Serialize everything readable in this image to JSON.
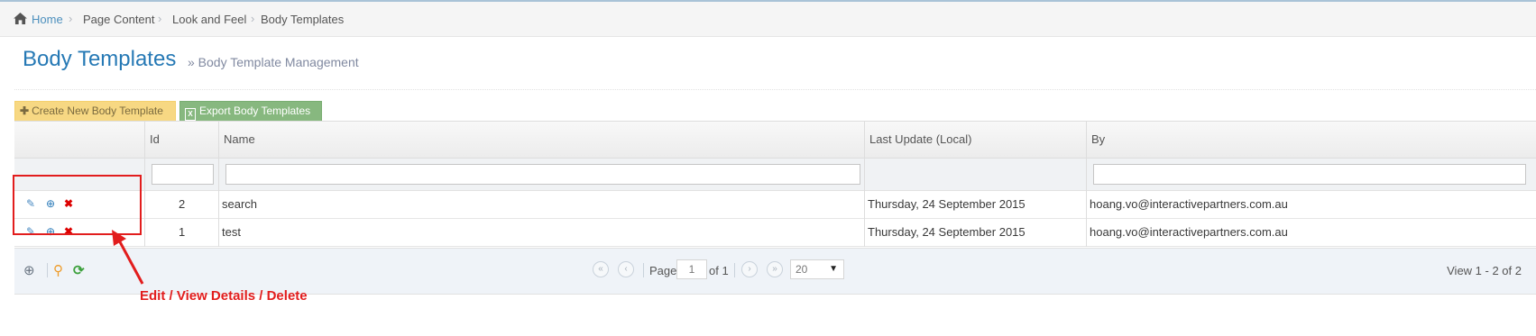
{
  "breadcrumb": {
    "home": "Home",
    "items": [
      "Page Content",
      "Look and Feel",
      "Body Templates"
    ]
  },
  "header": {
    "title": "Body Templates",
    "subtitle": "» Body Template Management"
  },
  "toolbar": {
    "create_label": "Create New Body Template",
    "export_label": "Export Body Templates"
  },
  "grid": {
    "columns": [
      "Id",
      "Name",
      "Last Update (Local)",
      "By"
    ],
    "rows": [
      {
        "id": "2",
        "name": "search",
        "updated": "Thursday, 24 September 2015",
        "by": "hoang.vo@interactivepartners.com.au"
      },
      {
        "id": "1",
        "name": "test",
        "updated": "Thursday, 24 September 2015",
        "by": "hoang.vo@interactivepartners.com.au"
      }
    ]
  },
  "pager": {
    "page_label": "Page",
    "page_value": "1",
    "of_label": "of 1",
    "page_size": "20",
    "view_text": "View 1 - 2 of 2"
  },
  "annotation": {
    "label": "Edit / View Details / Delete"
  },
  "colors": {
    "accent": "#2679b5",
    "create": "#f7d883",
    "export": "#87b87f",
    "annotation": "#e21d1d"
  },
  "icons": [
    "home-icon",
    "plus-icon",
    "excel-icon",
    "edit-icon",
    "view-icon",
    "delete-icon",
    "zoom-icon",
    "search-icon",
    "refresh-icon"
  ]
}
